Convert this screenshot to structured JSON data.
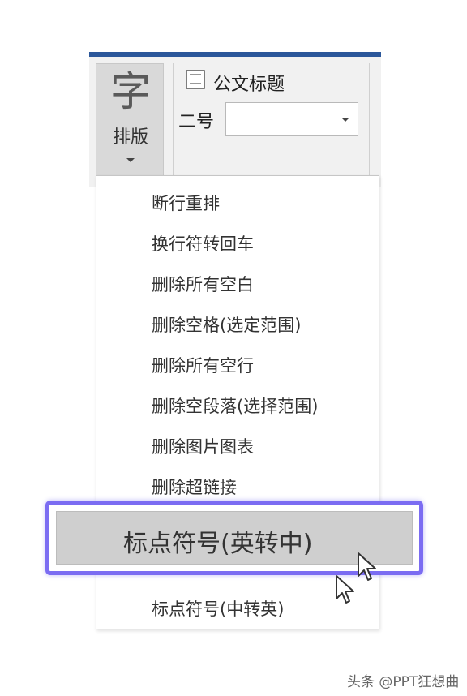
{
  "ribbon": {
    "typeset_icon_char": "字",
    "typeset_label": "排版",
    "heading_label": "公文标题",
    "size_label": "二号",
    "size_value": ""
  },
  "menu": {
    "items": [
      "断行重排",
      "换行符转回车",
      "删除所有空白",
      "删除空格(选定范围)",
      "删除所有空行",
      "删除空段落(选择范围)",
      "删除图片图表",
      "删除超链接",
      "标点符号(英转中)",
      "标点符号(中转英)"
    ]
  },
  "highlight": {
    "label": "标点符号(英转中)",
    "frame_color": "#7b6cf2"
  },
  "watermark": "头条 @PPT狂想曲",
  "colors": {
    "ribbon_accent": "#2b579a",
    "menu_bg": "#ffffff",
    "hover_bg": "#cfcfcf"
  }
}
